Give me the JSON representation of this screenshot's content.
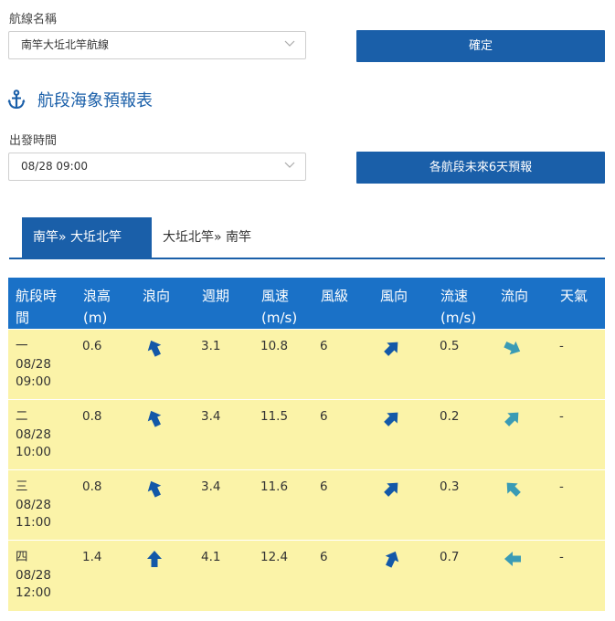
{
  "route": {
    "label": "航線名稱",
    "selected": "南竿大坵北竿航線",
    "confirm_label": "確定"
  },
  "section": {
    "title": "航段海象預報表",
    "icon": "anchor-icon"
  },
  "departure": {
    "label": "出發時間",
    "selected": "08/28 09:00",
    "forecast_button": "各航段未來6天預報"
  },
  "tabs": [
    {
      "label": "南竿» 大坵北竿",
      "active": true
    },
    {
      "label": "大坵北竿» 南竿",
      "active": false
    }
  ],
  "table": {
    "headers": [
      "航段時間",
      "浪高(m)",
      "浪向",
      "週期",
      "風速(m/s)",
      "風級",
      "風向",
      "流速(m/s)",
      "流向",
      "天氣"
    ],
    "header_lines": [
      [
        "航段時",
        "間"
      ],
      [
        "浪高",
        "(m)"
      ],
      [
        "浪向",
        ""
      ],
      [
        "週期",
        ""
      ],
      [
        "風速",
        "(m/s)"
      ],
      [
        "風級",
        ""
      ],
      [
        "風向",
        ""
      ],
      [
        "流速",
        "(m/s)"
      ],
      [
        "流向",
        ""
      ],
      [
        "天氣",
        ""
      ]
    ],
    "rows": [
      {
        "leg": "一",
        "date": "08/28",
        "time": "09:00",
        "wave_height": "0.6",
        "wave_dir_icon": "wave-direction-arrow-icon",
        "period": "3.1",
        "wind_speed": "10.8",
        "wind_level": "6",
        "wind_dir_icon": "wind-direction-arrow-icon",
        "current_speed": "0.5",
        "current_dir_icon": "current-direction-arrow-icon",
        "weather": "-"
      },
      {
        "leg": "二",
        "date": "08/28",
        "time": "10:00",
        "wave_height": "0.8",
        "wave_dir_icon": "wave-direction-arrow-icon",
        "period": "3.4",
        "wind_speed": "11.5",
        "wind_level": "6",
        "wind_dir_icon": "wind-direction-arrow-icon",
        "current_speed": "0.2",
        "current_dir_icon": "current-direction-arrow-icon",
        "weather": "-"
      },
      {
        "leg": "三",
        "date": "08/28",
        "time": "11:00",
        "wave_height": "0.8",
        "wave_dir_icon": "wave-direction-arrow-icon",
        "period": "3.4",
        "wind_speed": "11.6",
        "wind_level": "6",
        "wind_dir_icon": "wind-direction-arrow-icon",
        "current_speed": "0.3",
        "current_dir_icon": "current-direction-arrow-icon",
        "weather": "-"
      },
      {
        "leg": "四",
        "date": "08/28",
        "time": "12:00",
        "wave_height": "1.4",
        "wave_dir_icon": "wave-direction-arrow-icon",
        "period": "4.1",
        "wind_speed": "12.4",
        "wind_level": "6",
        "wind_dir_icon": "wind-direction-arrow-icon",
        "current_speed": "0.7",
        "current_dir_icon": "current-direction-arrow-icon",
        "weather": "-"
      }
    ]
  },
  "colors": {
    "primary": "#1a5fa9",
    "header_bg": "#1a71c7",
    "row_bg": "#fbf3a8",
    "arrow_dark": "#1358a8",
    "arrow_teal": "#3a9bb5"
  }
}
